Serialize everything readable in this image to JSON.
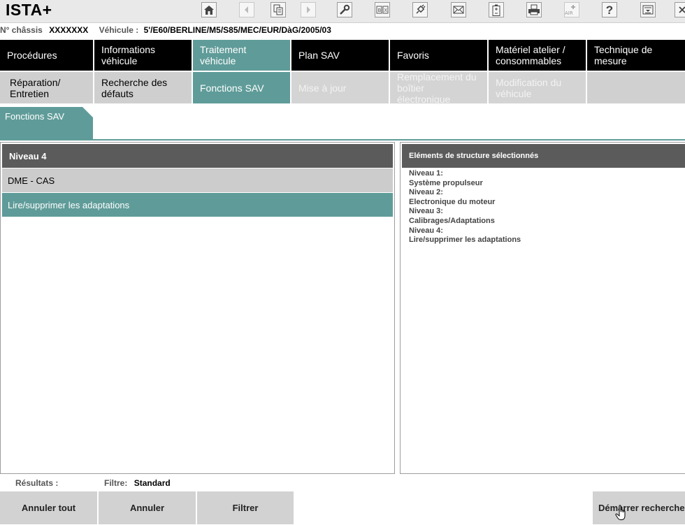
{
  "app": {
    "title": "ISTA+"
  },
  "toolbar": {
    "icons": [
      "home-icon",
      "back-icon",
      "documents-icon",
      "forward-icon",
      "wrench-icon",
      "bx-icon",
      "plug-icon",
      "mail-icon",
      "battery-icon",
      "print-icon",
      "air-icon",
      "help-icon",
      "download-icon",
      "close-icon"
    ],
    "air_label": "AIR",
    "help_label": "?"
  },
  "vehicle": {
    "chassis_label": "N° châssis",
    "chassis_value": "XXXXXXX",
    "vehicle_label": "Véhicule :",
    "vehicle_value": "5'/E60/BERLINE/M5/S85/MEC/EUR/DàG/2005/03"
  },
  "main_tabs": [
    {
      "label": "Procédures",
      "active": false
    },
    {
      "label": "Informations véhicule",
      "active": false
    },
    {
      "label": "Traitement véhicule",
      "active": true
    },
    {
      "label": "Plan SAV",
      "active": false
    },
    {
      "label": "Favoris",
      "active": false
    },
    {
      "label": "Matériel atelier / consommables",
      "active": false
    },
    {
      "label": "Technique de mesure",
      "active": false
    }
  ],
  "sub_tabs": [
    {
      "label": "Réparation/ Entretien",
      "state": "normal"
    },
    {
      "label": "Recherche des défauts",
      "state": "normal"
    },
    {
      "label": "Fonctions SAV",
      "state": "active"
    },
    {
      "label": "Mise à jour",
      "state": "disabled"
    },
    {
      "label": "Remplacement du boîtier électronique",
      "state": "disabled"
    },
    {
      "label": "Modification du véhicule",
      "state": "disabled"
    },
    {
      "label": "",
      "state": "normal"
    }
  ],
  "breadcrumb": {
    "label": "Fonctions SAV"
  },
  "left_panel": {
    "header": "Niveau 4",
    "rows": [
      "DME - CAS",
      "Lire/supprimer les adaptations"
    ]
  },
  "right_panel": {
    "header": "Eléments de structure sélectionnés",
    "lines": [
      "Niveau 1:",
      "Système propulseur",
      "Niveau 2:",
      "Electronique du moteur",
      "Niveau 3:",
      "Calibrages/Adaptations",
      "Niveau 4:",
      "Lire/supprimer les adaptations"
    ]
  },
  "footer": {
    "results_label": "Résultats :",
    "filter_label": "Filtre:",
    "filter_value": "Standard",
    "buttons": {
      "cancel_all": "Annuler tout",
      "cancel": "Annuler",
      "filter": "Filtrer",
      "start_search": "Démarrer recherche"
    }
  },
  "colors": {
    "accent_teal": "#5f9c99",
    "header_dark": "#5b5b5b",
    "tab_black": "#000000",
    "tab_grey": "#cfcfcf"
  }
}
